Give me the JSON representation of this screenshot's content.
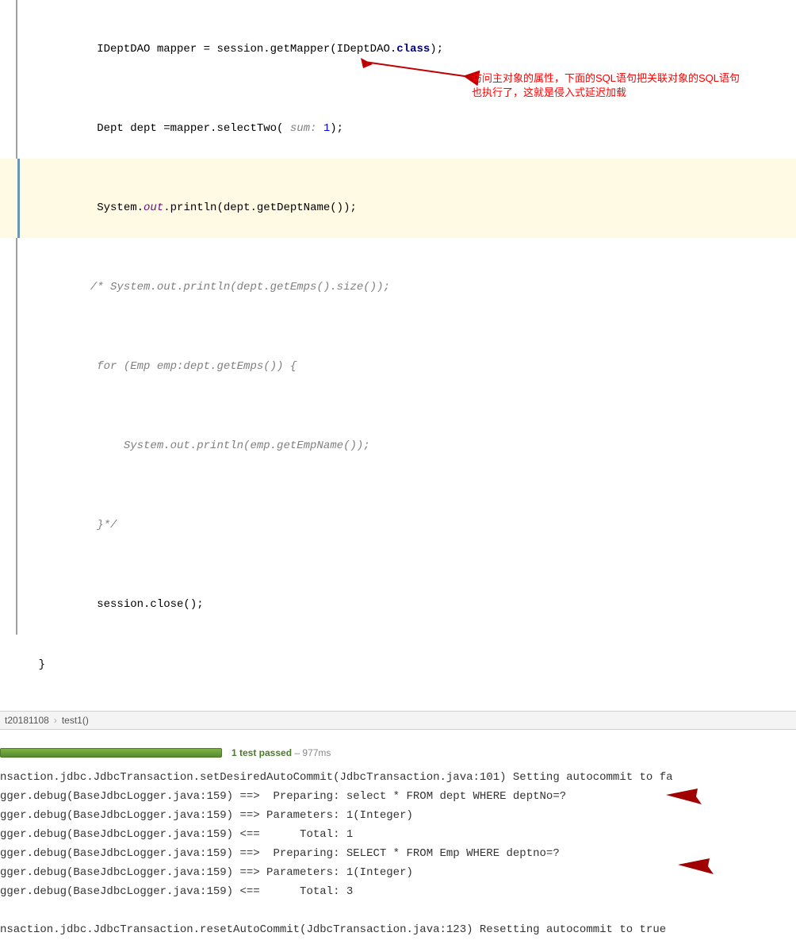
{
  "code": {
    "line1": "    IDeptDAO mapper = session.getMapper(IDeptDAO.",
    "line1_class": "class",
    "line1_end": ");",
    "line2_a": "    Dept dept =mapper.selectTwo(",
    "line2_hint": " sum: ",
    "line2_num": "1",
    "line2_end": ");",
    "line3_a": "    System.",
    "line3_out": "out",
    "line3_b": ".println(dept.getDeptName());",
    "line4": "   /* System.out.println(dept.getEmps().size());",
    "line5": "    for (Emp emp:dept.getEmps()) {",
    "line6": "        System.out.println(emp.getEmpName());",
    "line7": "    }*/",
    "line8": "    session.close();",
    "line9": "}"
  },
  "annotation": {
    "text1": "访问主对象的属性，下面的SQL语句把关联对象的SQL语句",
    "text2": "也执行了，这就是侵入式延迟加载"
  },
  "breadcrumb": {
    "item1": "t20181108",
    "item2": "test1()"
  },
  "test": {
    "status": "1 test passed",
    "time": " – 977ms"
  },
  "console": {
    "l1": "nsaction.jdbc.JdbcTransaction.setDesiredAutoCommit(JdbcTransaction.java:101) Setting autocommit to fa",
    "l2": "gger.debug(BaseJdbcLogger.java:159) ==>  Preparing: select * FROM dept WHERE deptNo=?",
    "l3": "gger.debug(BaseJdbcLogger.java:159) ==> Parameters: 1(Integer)",
    "l4": "gger.debug(BaseJdbcLogger.java:159) <==      Total: 1",
    "l5": "gger.debug(BaseJdbcLogger.java:159) ==>  Preparing: SELECT * FROM Emp WHERE deptno=?",
    "l6": "gger.debug(BaseJdbcLogger.java:159) ==> Parameters: 1(Integer)",
    "l7": "gger.debug(BaseJdbcLogger.java:159) <==      Total: 3",
    "l8": " ",
    "l9": "nsaction.jdbc.JdbcTransaction.resetAutoCommit(JdbcTransaction.java:123) Resetting autocommit to true"
  }
}
